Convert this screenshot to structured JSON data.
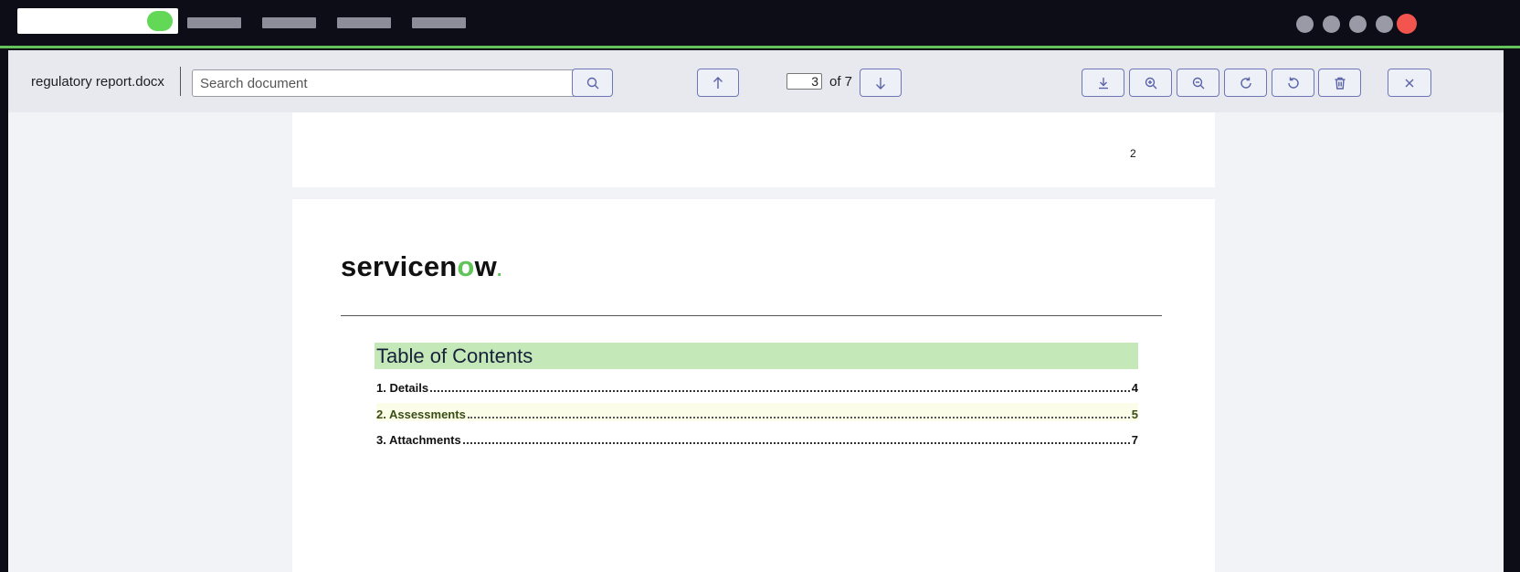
{
  "toolbar": {
    "filename": "regulatory report.docx",
    "search_placeholder": "Search document",
    "current_page": "3",
    "page_of": "of 7"
  },
  "document": {
    "prev_page_number": "2",
    "logo_text_a": "servicen",
    "logo_text_o": "o",
    "logo_text_b": "w",
    "logo_dot": ".",
    "toc_title": "Table of Contents",
    "toc": [
      {
        "label": "1. Details",
        "page": "4"
      },
      {
        "label": "2. Assessments",
        "page": "5"
      },
      {
        "label": "3. Attachments",
        "page": "7"
      }
    ]
  },
  "colors": {
    "accent_green": "#63c35a",
    "toc_heading_bg": "#c4e8b8",
    "button_border": "#6e76b8",
    "close_dot": "#f4544e"
  },
  "icons": [
    "search-icon",
    "arrow-up-icon",
    "arrow-down-icon",
    "download-icon",
    "zoom-in-icon",
    "zoom-out-icon",
    "rotate-cw-icon",
    "rotate-ccw-icon",
    "trash-icon",
    "close-icon"
  ]
}
